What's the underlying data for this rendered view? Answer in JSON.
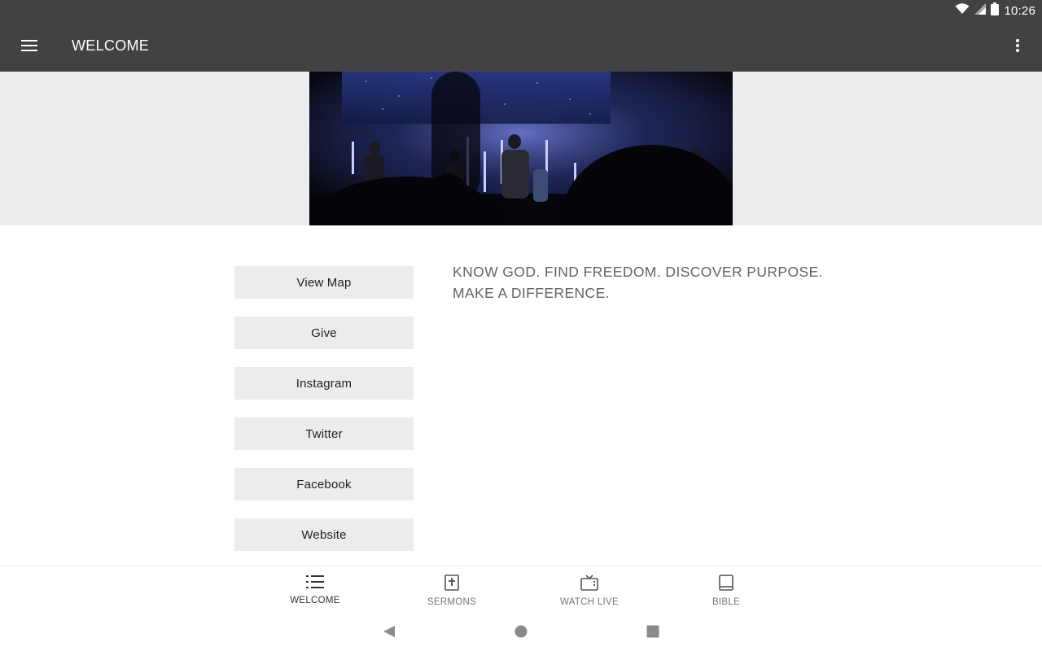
{
  "status_bar": {
    "time": "10:26",
    "icons": [
      "wifi-icon",
      "cell-signal-icon",
      "battery-icon"
    ]
  },
  "app_bar": {
    "title": "WELCOME",
    "menu_icon": "hamburger-menu-icon",
    "overflow_icon": "more-vertical-icon"
  },
  "hero": {
    "description_icon": "stage-photo"
  },
  "links": [
    {
      "label": "View Map"
    },
    {
      "label": "Give"
    },
    {
      "label": "Instagram"
    },
    {
      "label": "Twitter"
    },
    {
      "label": "Facebook"
    },
    {
      "label": "Website"
    }
  ],
  "tagline": "KNOW GOD. FIND FREEDOM. DISCOVER PURPOSE.\nMAKE A DIFFERENCE.",
  "bottom_nav": {
    "items": [
      {
        "label": "WELCOME",
        "icon": "list-icon",
        "active": true
      },
      {
        "label": "SERMONS",
        "icon": "bible-cross-icon",
        "active": false
      },
      {
        "label": "WATCH LIVE",
        "icon": "tv-icon",
        "active": false
      },
      {
        "label": "BIBLE",
        "icon": "book-icon",
        "active": false
      }
    ]
  },
  "system_nav": {
    "icons": [
      "back-icon",
      "home-icon",
      "recents-icon"
    ]
  },
  "colors": {
    "app_bar": "#424244",
    "hero_bg": "#ebecee",
    "button_bg": "#ebecee",
    "tagline_text": "#646464",
    "nav_label": "#757575"
  }
}
